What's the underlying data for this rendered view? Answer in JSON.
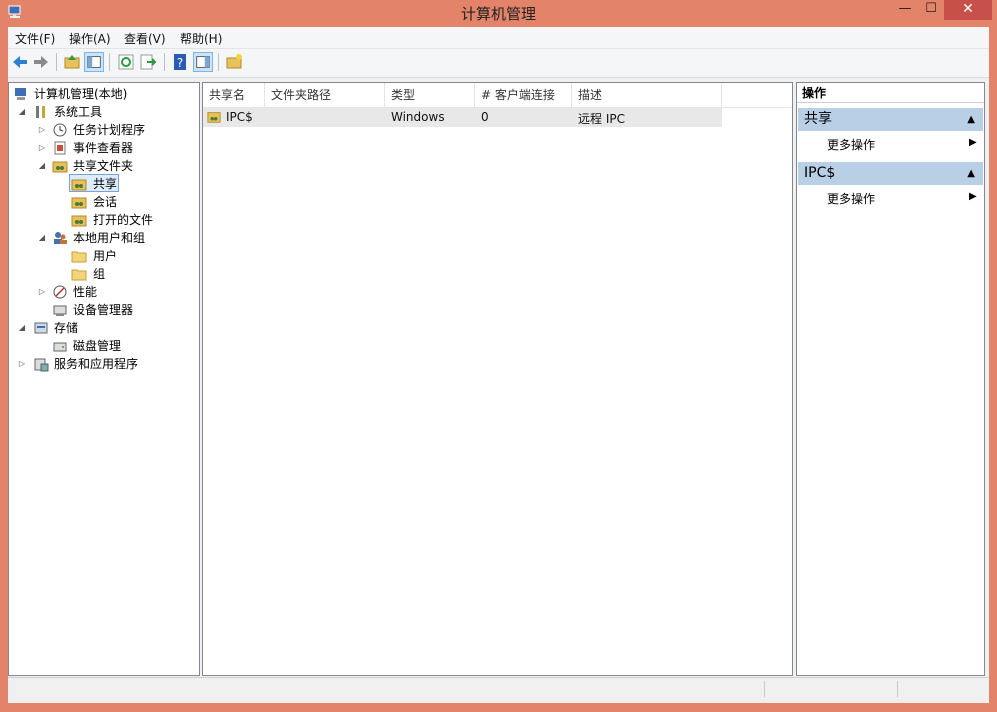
{
  "window": {
    "title": "计算机管理",
    "min_glyph": "—",
    "max_glyph": "☐",
    "close_glyph": "✕"
  },
  "menu": [
    "文件(F)",
    "操作(A)",
    "查看(V)",
    "帮助(H)"
  ],
  "toolbar": [
    "back-icon",
    "forward-icon",
    "up-folder-icon",
    "show-hide-tree-icon",
    "refresh-icon",
    "export-list-icon",
    "help-icon",
    "show-hide-action-pane-icon",
    "new-share-icon"
  ],
  "tree": {
    "root": "计算机管理(本地)",
    "system_tools": "系统工具",
    "task_scheduler": "任务计划程序",
    "event_viewer": "事件查看器",
    "shared_folders": "共享文件夹",
    "shares": "共享",
    "sessions": "会话",
    "open_files": "打开的文件",
    "local_users_groups": "本地用户和组",
    "users": "用户",
    "groups": "组",
    "performance": "性能",
    "device_manager": "设备管理器",
    "storage": "存储",
    "disk_management": "磁盘管理",
    "services_apps": "服务和应用程序"
  },
  "list": {
    "columns": [
      "共享名",
      "文件夹路径",
      "类型",
      "# 客户端连接",
      "描述"
    ],
    "rows": [
      {
        "name": "IPC$",
        "path": "",
        "type": "Windows",
        "clients": "0",
        "desc": "远程 IPC"
      }
    ]
  },
  "actions": {
    "title": "操作",
    "section1": "共享",
    "section1_item": "更多操作",
    "section2": "IPC$",
    "section2_item": "更多操作"
  }
}
